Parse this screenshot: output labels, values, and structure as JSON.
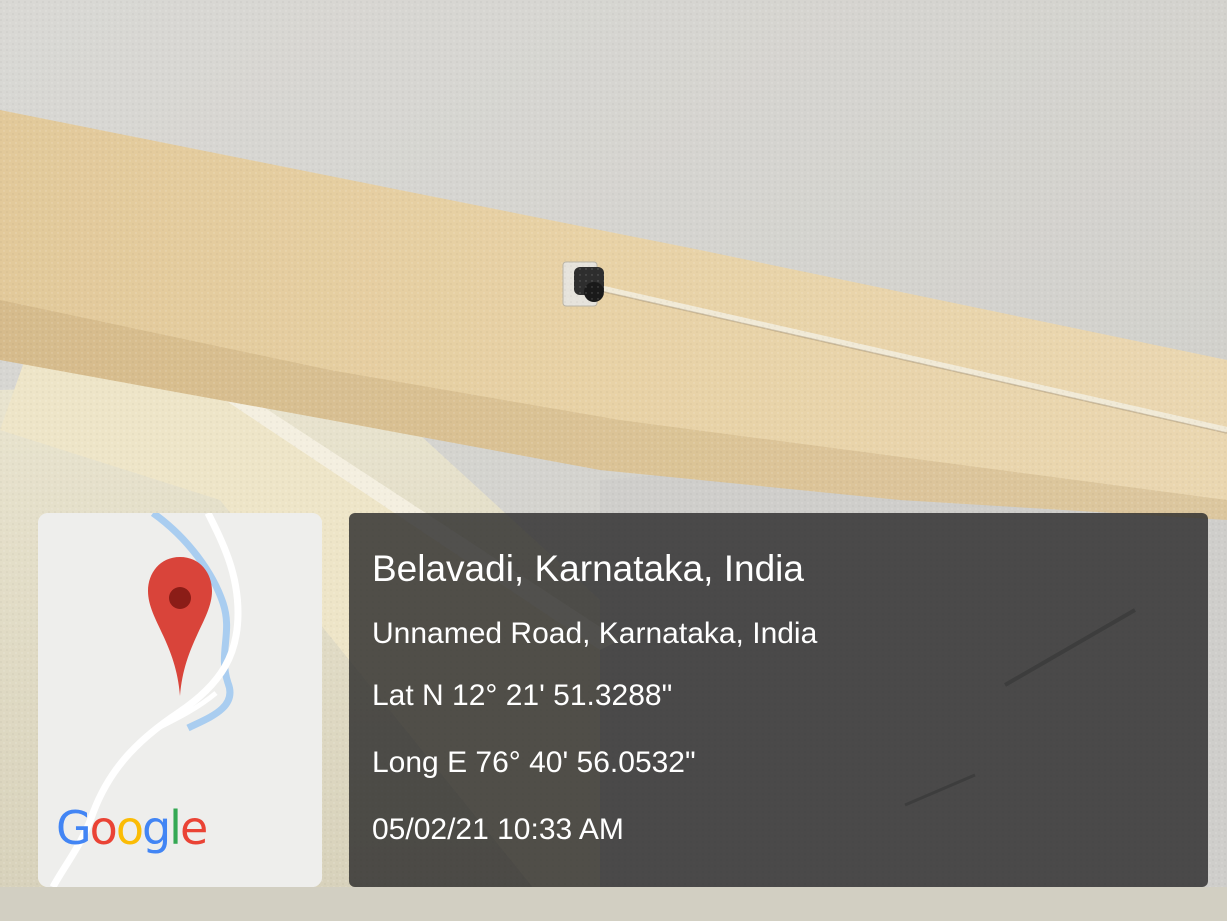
{
  "map": {
    "logo_text": "Google",
    "logo_colors": [
      "#4285F4",
      "#EA4335",
      "#FBBC05",
      "#4285F4",
      "#34A853",
      "#EA4335"
    ],
    "pin_color": "#D9443A",
    "pin_icon": "map-pin-icon"
  },
  "location": {
    "title": "Belavadi, Karnataka, India",
    "address": "Unnamed Road, Karnataka, India",
    "latitude": "Lat N 12° 21' 51.3288\"",
    "longitude": "Long E 76° 40' 56.0532\"",
    "datetime": "05/02/21 10:33 AM"
  }
}
